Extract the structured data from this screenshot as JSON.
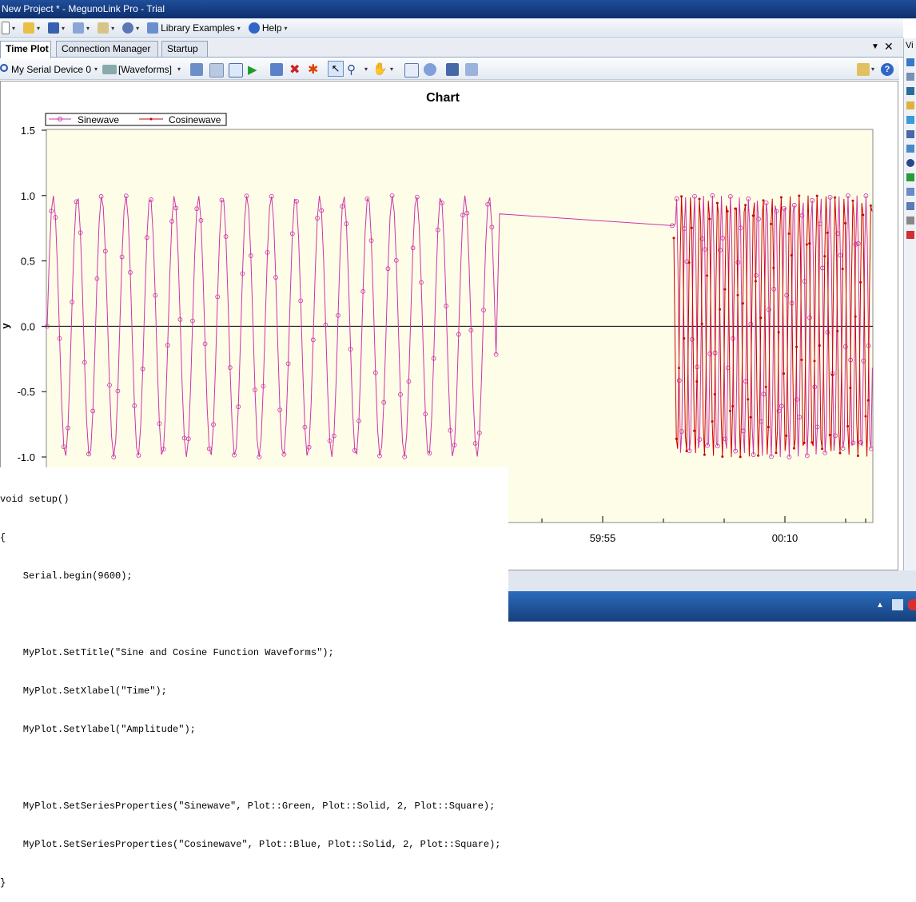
{
  "window": {
    "title": "New Project * - MegunoLink Pro - Trial"
  },
  "menu": {
    "items": [
      {
        "label": "",
        "icon": "new-icon"
      },
      {
        "label": "",
        "icon": "open-folder-icon"
      },
      {
        "label": "",
        "icon": "save-icon"
      },
      {
        "label": "",
        "icon": "connection-icon"
      },
      {
        "label": "",
        "icon": "script-icon"
      },
      {
        "label": "",
        "icon": "settings-gear-icon"
      },
      {
        "label": "Library Examples",
        "icon": "library-icon"
      },
      {
        "label": "Help",
        "icon": "help-icon"
      }
    ]
  },
  "tabs": [
    {
      "label": "Time Plot",
      "active": true
    },
    {
      "label": "Connection Manager",
      "active": false
    },
    {
      "label": "Startup",
      "active": false
    }
  ],
  "side_tab_label": "Vi",
  "toolbar": {
    "device": "My Serial Device 0",
    "channel": "[Waveforms]"
  },
  "chart_data": {
    "type": "line",
    "title": "Chart",
    "ylabel": "y",
    "xlabel": "",
    "ylim": [
      -1.0,
      1.5
    ],
    "yticks": [
      "1.5",
      "1.0",
      "0.5",
      "0.0",
      "-0.5",
      "-1.0"
    ],
    "xticks": [
      "59:55",
      "00:10"
    ],
    "grid": false,
    "legend_position": "top-left",
    "background": "#fefee8",
    "series": [
      {
        "name": "Sinewave",
        "color": "#cc33aa",
        "marker": "circle"
      },
      {
        "name": "Cosinewave",
        "color": "#cc0000",
        "marker": "diamond"
      }
    ]
  },
  "code": {
    "lines": [
      "void setup()",
      "{",
      "    Serial.begin(9600);",
      "",
      "    MyPlot.SetTitle(\"Sine and Cosine Function Waveforms\");",
      "    MyPlot.SetXlabel(\"Time\");",
      "    MyPlot.SetYlabel(\"Amplitude\");",
      "",
      "    MyPlot.SetSeriesProperties(\"Sinewave\", Plot::Green, Plot::Solid, 2, Plot::Square);",
      "    MyPlot.SetSeriesProperties(\"Cosinewave\", Plot::Blue, Plot::Solid, 2, Plot::Square);",
      "}"
    ]
  }
}
